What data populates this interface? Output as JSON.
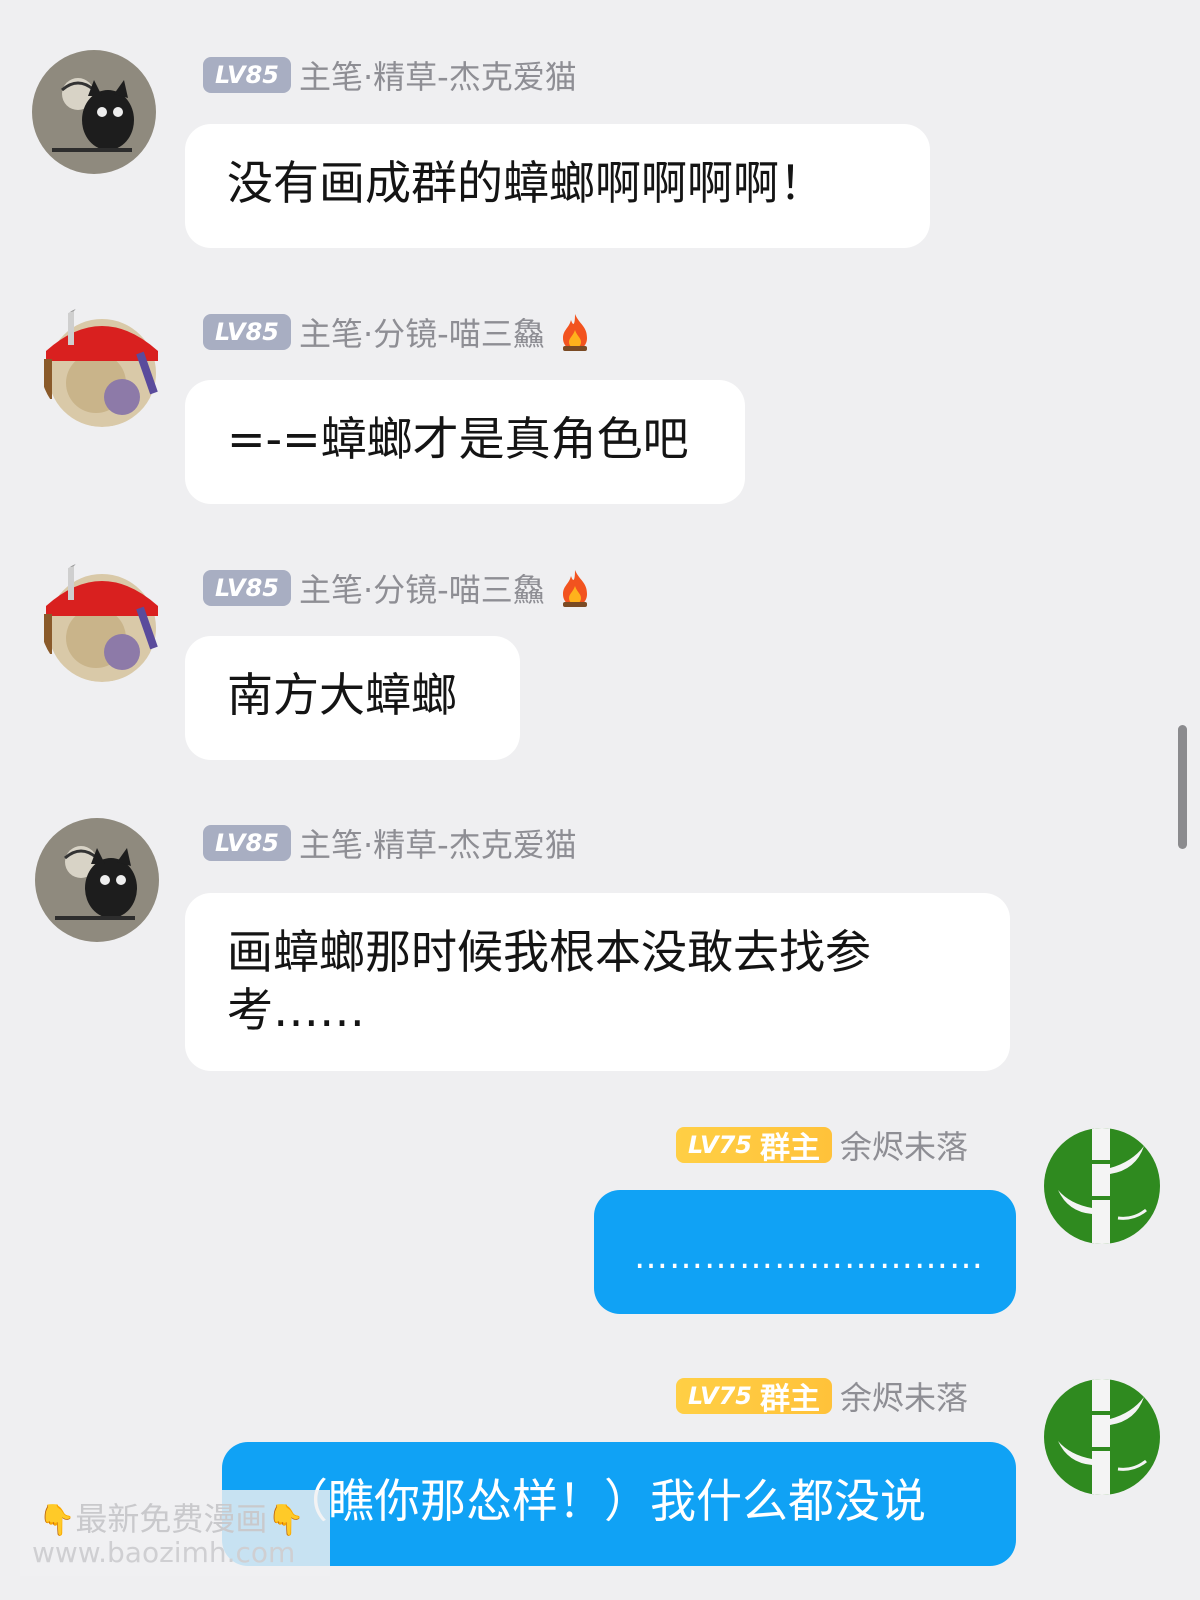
{
  "messages": [
    {
      "level": "LV85",
      "role": "主笔·精草",
      "name": "-杰克爱猫",
      "text": "没有画成群的蟑螂啊啊啊啊！"
    },
    {
      "level": "LV85",
      "role": "主笔·分镜",
      "name": "-喵三鱻",
      "text": "=-=蟑螂才是真角色吧"
    },
    {
      "level": "LV85",
      "role": "主笔·分镜",
      "name": "-喵三鱻",
      "text": "南方大蟑螂"
    },
    {
      "level": "LV85",
      "role": "主笔·精草",
      "name": "-杰克爱猫",
      "text_line1": "画蟑螂那时候我根本没敢去找参",
      "text_line2": "考……"
    },
    {
      "level": "LV75",
      "role": "群主",
      "name": "余烬未落",
      "text": "…………………………"
    },
    {
      "level": "LV75",
      "role": "群主",
      "name": "余烬未落",
      "text": "（瞧你那怂样！）我什么都没说"
    }
  ],
  "watermark": {
    "line1": "最新免费漫画",
    "line2": "www.baozimh.com"
  },
  "colors": {
    "background": "#efeff1",
    "self_bubble": "#10a2f5",
    "level_gray": "#a8aec2",
    "level_gold": "#ffc23a"
  },
  "icons": {
    "fire": "fire-icon",
    "pointing_finger": "pointing-down-icon"
  }
}
